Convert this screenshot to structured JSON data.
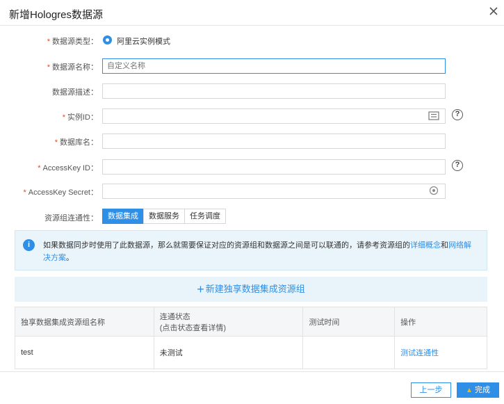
{
  "dialog": {
    "title": "新增Hologres数据源"
  },
  "form": {
    "type": {
      "label": "数据源类型：",
      "option": "阿里云实例模式"
    },
    "name": {
      "label": "数据源名称：",
      "placeholder": "自定义名称"
    },
    "desc": {
      "label": "数据源描述："
    },
    "instance": {
      "label": "实例ID："
    },
    "db": {
      "label": "数据库名："
    },
    "akid": {
      "label": "AccessKey ID："
    },
    "aksecret": {
      "label": "AccessKey Secret："
    },
    "conn": {
      "label": "资源组连通性：",
      "tabs": [
        "数据集成",
        "数据服务",
        "任务调度"
      ],
      "active_tab": "数据集成"
    }
  },
  "info": {
    "text": "如果数据同步时使用了此数据源，那么就需要保证对应的资源组和数据源之间是可以联通的，请参考资源组的",
    "link1": "详细概念",
    "and": "和",
    "link2": "网络解决方案",
    "end": "。"
  },
  "add_bar": {
    "label": "新建独享数据集成资源组"
  },
  "table": {
    "headers": [
      "独享数据集成资源组名称",
      "连通状态",
      "(点击状态查看详情)",
      "测试时间",
      "操作"
    ],
    "rows": [
      {
        "name": "test",
        "status": "未测试",
        "time": "",
        "action": "测试连通性"
      }
    ]
  },
  "footer": {
    "prev": "上一步",
    "done": "完成"
  },
  "colors": {
    "accent": "#2f8ee5",
    "required": "#e64a19",
    "info_bg": "#eaf5fb"
  }
}
